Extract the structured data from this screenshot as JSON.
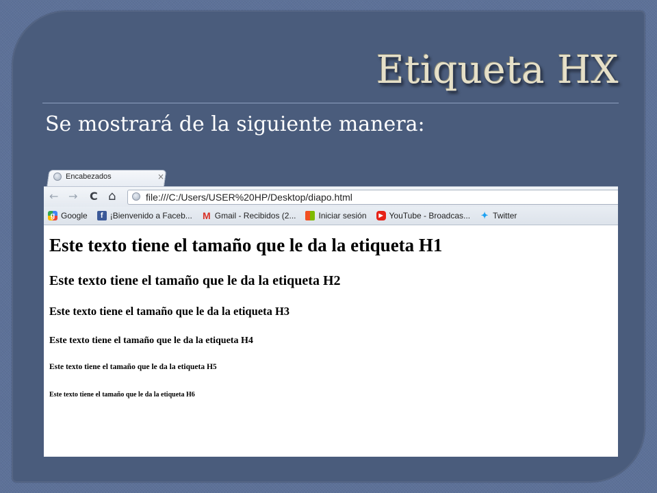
{
  "slide": {
    "title": "Etiqueta HX",
    "subtitle": "Se mostrará de la siguiente manera:"
  },
  "browser": {
    "tab": {
      "title": "Encabezados",
      "close": "×"
    },
    "toolbar": {
      "back": "←",
      "forward": "→",
      "reload": "C",
      "home": "⌂",
      "url": "file:///C:/Users/USER%20HP/Desktop/diapo.html"
    },
    "bookmarks": [
      {
        "label": "Google",
        "icon": "google-icon"
      },
      {
        "label": "¡Bienvenido a Faceb...",
        "icon": "facebook-icon"
      },
      {
        "label": "Gmail - Recibidos (2...",
        "icon": "gmail-icon"
      },
      {
        "label": "Iniciar sesión",
        "icon": "windows-live-icon"
      },
      {
        "label": "YouTube - Broadcas...",
        "icon": "youtube-icon"
      },
      {
        "label": "Twitter",
        "icon": "twitter-icon"
      }
    ],
    "page": {
      "h1": "Este texto tiene el tamaño que le da la etiqueta H1",
      "h2": "Este texto tiene el tamaño que le da la etiqueta H2",
      "h3": "Este texto tiene el tamaño que le da la etiqueta H3",
      "h4": "Este texto tiene el tamaño que le da la etiqueta H4",
      "h5": "Este texto tiene el tamaño que le da la etiqueta H5",
      "h6": "Este texto tiene el tamaño que le da la etiqueta H6"
    }
  }
}
